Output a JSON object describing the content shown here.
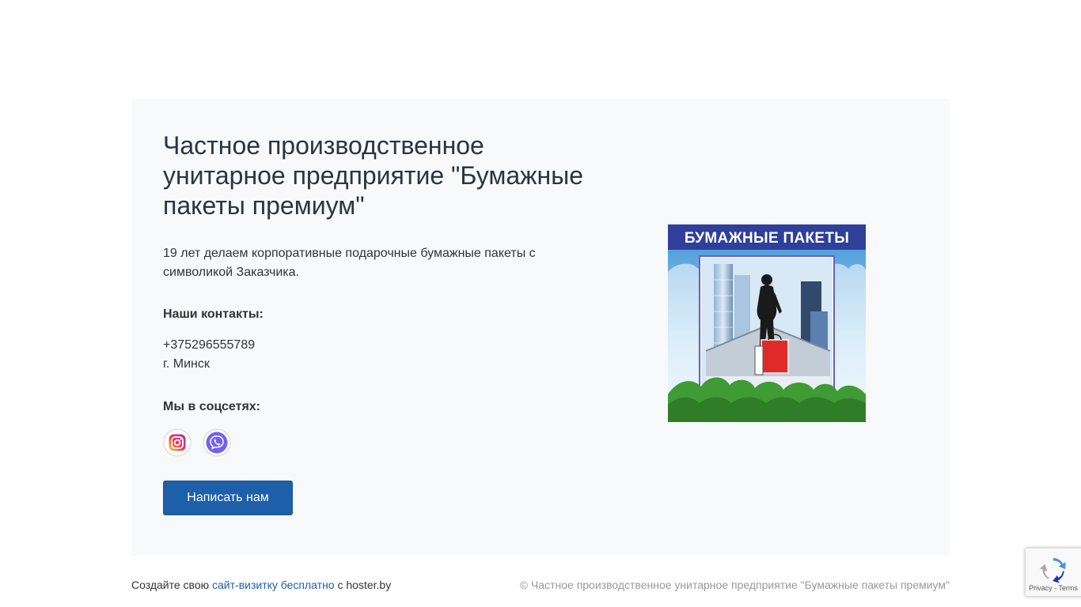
{
  "company": {
    "title": "Частное производственное унитарное предприятие \"Бумажные пакеты премиум\"",
    "tagline": "19 лет делаем корпоративные подарочные бумажные пакеты с символикой Заказчика."
  },
  "contacts": {
    "heading": "Наши контакты:",
    "phone": "+375296555789",
    "city": "г. Минск"
  },
  "social": {
    "heading": "Мы в соцсетях:",
    "icons": [
      "instagram-icon",
      "viber-icon"
    ]
  },
  "actions": {
    "write_label": "Написать нам"
  },
  "logo": {
    "caption": "БУМАЖНЫЕ ПАКЕТЫ"
  },
  "footer": {
    "prefix": "Создайте свою",
    "link_text": "сайт-визитку бесплатно",
    "suffix": "с hoster.by",
    "copyright": "© Частное производственное унитарное предприятие \"Бумажные пакеты премиум\""
  },
  "recaptcha": {
    "links": "Privacy - Terms"
  },
  "colors": {
    "accent": "#1d5fa8",
    "card_background": "#f8f9fa",
    "muted_text": "#999999"
  }
}
